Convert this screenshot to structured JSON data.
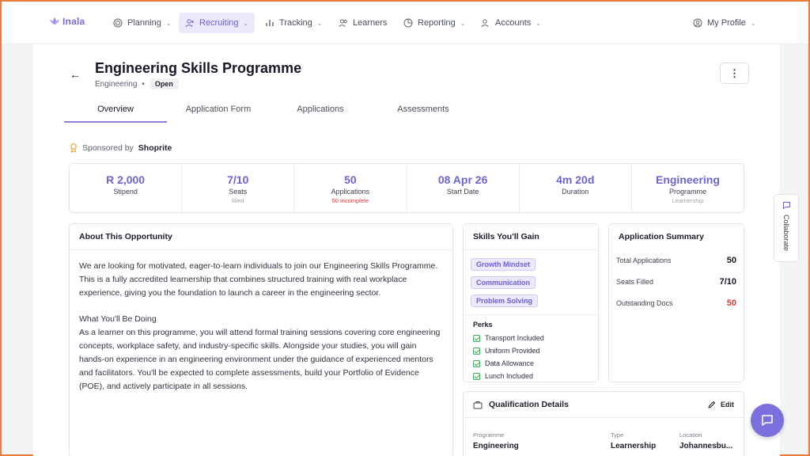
{
  "brand": {
    "name": "Inala",
    "accent": "#7a6fdc"
  },
  "nav": {
    "items": [
      {
        "label": "Planning",
        "icon": "target-icon",
        "dropdown": true
      },
      {
        "label": "Recruiting",
        "icon": "user-plus-icon",
        "dropdown": true,
        "active": true
      },
      {
        "label": "Tracking",
        "icon": "bar-chart-icon",
        "dropdown": true
      },
      {
        "label": "Learners",
        "icon": "users-icon",
        "dropdown": false
      },
      {
        "label": "Reporting",
        "icon": "pie-chart-icon",
        "dropdown": true
      },
      {
        "label": "Accounts",
        "icon": "user-group-icon",
        "dropdown": true
      }
    ],
    "profile": "My Profile"
  },
  "header": {
    "title": "Engineering Skills Programme",
    "category": "Engineering",
    "separator": "•",
    "status": "Open"
  },
  "tabs": [
    "Overview",
    "Application Form",
    "Applications",
    "Assessments"
  ],
  "sponsor": {
    "prefix": "Sponsored by",
    "name": "Shoprite"
  },
  "stats": [
    {
      "value": "R 2,000",
      "label": "Stipend",
      "sub": ""
    },
    {
      "value": "7/10",
      "label": "Seats",
      "sub": "filled"
    },
    {
      "value": "50",
      "label": "Applications",
      "sub": "50 incomplete"
    },
    {
      "value": "08 Apr 26",
      "label": "Start Date",
      "sub": ""
    },
    {
      "value": "4m 20d",
      "label": "Duration",
      "sub": ""
    },
    {
      "value": "Engineering",
      "label": "Programme",
      "sub": "Learnership"
    }
  ],
  "about": {
    "title": "About This Opportunity",
    "p1": "We are looking for motivated, eager-to-learn individuals to join our Engineering Skills Programme. This is a fully accredited learnership that combines structured training with real workplace experience, giving you the foundation to launch a career in the engineering sector.",
    "heading2": "What You'll Be Doing",
    "p2": "As a learner on this programme, you will attend formal training sessions covering core engineering concepts, workplace safety, and industry-specific skills. Alongside your studies, you will gain hands-on experience in an engineering environment under the guidance of experienced mentors and facilitators. You'll be expected to complete assessments, build your Portfolio of Evidence (POE), and actively participate in all sessions."
  },
  "skills": {
    "title": "Skills You'll Gain",
    "chips": [
      "Growth Mindset",
      "Communication",
      "Problem Solving"
    ],
    "perks_title": "Perks",
    "perks": [
      "Transport Included",
      "Uniform Provided",
      "Data Allowance",
      "Lunch Included"
    ]
  },
  "summary": {
    "title": "Application Summary",
    "rows": [
      {
        "label": "Total Applications",
        "value": "50"
      },
      {
        "label": "Seats Filled",
        "value": "7/10"
      },
      {
        "label": "Outstanding Docs",
        "value": "50"
      }
    ]
  },
  "qualification": {
    "title": "Qualification Details",
    "edit_label": "Edit",
    "cols": [
      {
        "label": "Programme",
        "value": "Engineering"
      },
      {
        "label": "Type",
        "value": "Learnership"
      },
      {
        "label": "Location",
        "value": "Johannesbu..."
      }
    ]
  },
  "collaborate": "Collaborate"
}
